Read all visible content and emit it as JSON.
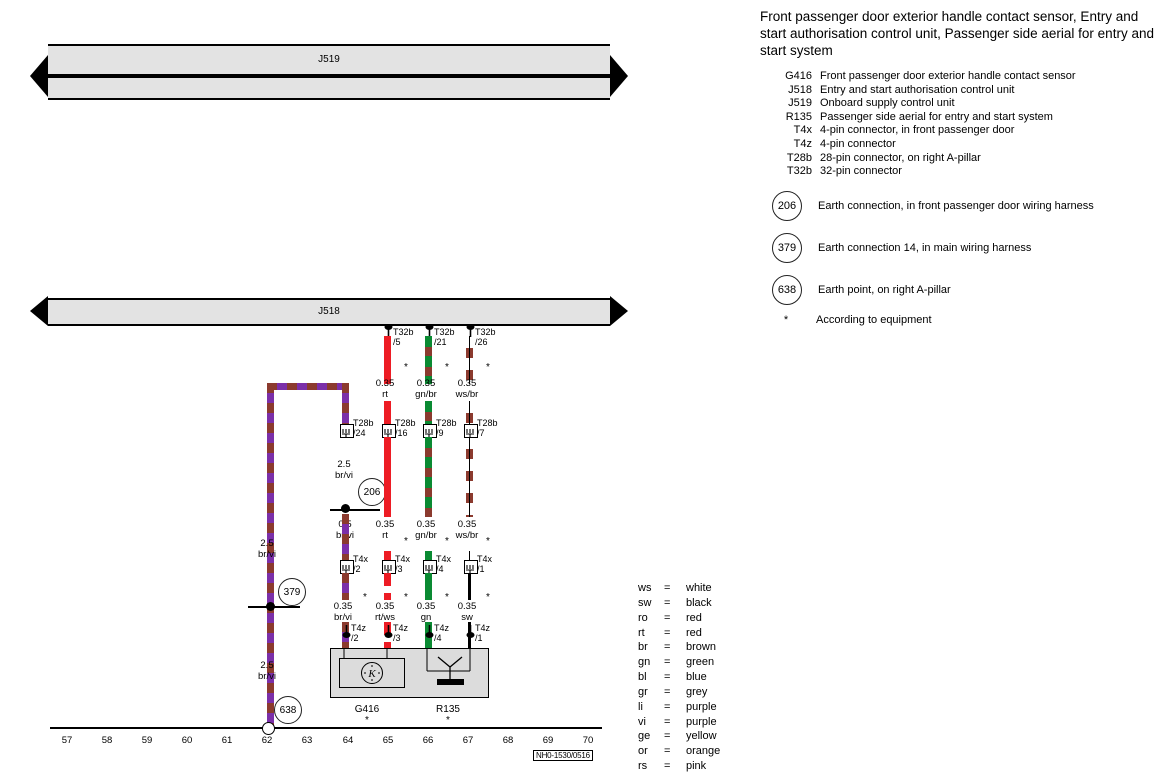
{
  "legend": {
    "title": "Front passenger door exterior handle contact sensor, Entry and start authorisation control unit, Passenger side aerial for entry and start system",
    "codes": [
      {
        "key": "G416",
        "desc": "Front passenger door exterior handle contact sensor"
      },
      {
        "key": "J518",
        "desc": "Entry and start authorisation control unit"
      },
      {
        "key": "J519",
        "desc": "Onboard supply control unit"
      },
      {
        "key": "R135",
        "desc": "Passenger side aerial for entry and start system"
      },
      {
        "key": "T4x",
        "desc": "4-pin connector, in front passenger door"
      },
      {
        "key": "T4z",
        "desc": "4-pin connector"
      },
      {
        "key": "T28b",
        "desc": "28-pin connector, on right A-pillar"
      },
      {
        "key": "T32b",
        "desc": "32-pin connector"
      }
    ],
    "earths": [
      {
        "num": "206",
        "desc": "Earth connection, in front passenger door wiring harness"
      },
      {
        "num": "379",
        "desc": "Earth connection 14, in main wiring harness"
      },
      {
        "num": "638",
        "desc": "Earth point, on right A-pillar"
      }
    ],
    "footnote": {
      "mark": "*",
      "desc": "According to equipment"
    }
  },
  "colour_legend": [
    {
      "abbr": "ws",
      "eq": "=",
      "name": "white"
    },
    {
      "abbr": "sw",
      "eq": "=",
      "name": "black"
    },
    {
      "abbr": "ro",
      "eq": "=",
      "name": "red"
    },
    {
      "abbr": "rt",
      "eq": "=",
      "name": "red"
    },
    {
      "abbr": "br",
      "eq": "=",
      "name": "brown"
    },
    {
      "abbr": "gn",
      "eq": "=",
      "name": "green"
    },
    {
      "abbr": "bl",
      "eq": "=",
      "name": "blue"
    },
    {
      "abbr": "gr",
      "eq": "=",
      "name": "grey"
    },
    {
      "abbr": "li",
      "eq": "=",
      "name": "purple"
    },
    {
      "abbr": "vi",
      "eq": "=",
      "name": "purple"
    },
    {
      "abbr": "ge",
      "eq": "=",
      "name": "yellow"
    },
    {
      "abbr": "or",
      "eq": "=",
      "name": "orange"
    },
    {
      "abbr": "rs",
      "eq": "=",
      "name": "pink"
    }
  ],
  "busbars": {
    "top": {
      "label": "J519"
    },
    "bottom": {
      "label": "J518"
    }
  },
  "connectors": {
    "t32b": [
      {
        "name": "T32b",
        "pin": "/5"
      },
      {
        "name": "T32b",
        "pin": "/21"
      },
      {
        "name": "T32b",
        "pin": "/26"
      }
    ],
    "t28b": [
      {
        "name": "T28b",
        "pin": "/24"
      },
      {
        "name": "T28b",
        "pin": "/16"
      },
      {
        "name": "T28b",
        "pin": "/9"
      },
      {
        "name": "T28b",
        "pin": "/7"
      }
    ],
    "t4x": [
      {
        "name": "T4x",
        "pin": "/2"
      },
      {
        "name": "T4x",
        "pin": "/3"
      },
      {
        "name": "T4x",
        "pin": "/4"
      },
      {
        "name": "T4x",
        "pin": "/1"
      }
    ],
    "t4z": [
      {
        "name": "T4z",
        "pin": "/2"
      },
      {
        "name": "T4z",
        "pin": "/3"
      },
      {
        "name": "T4z",
        "pin": "/4"
      },
      {
        "name": "T4z",
        "pin": "/1"
      }
    ]
  },
  "wire_labels": {
    "upper": [
      {
        "size": "0.35",
        "colour": "rt"
      },
      {
        "size": "0.35",
        "colour": "gn/br"
      },
      {
        "size": "0.35",
        "colour": "ws/br"
      }
    ],
    "mid_left": {
      "size": "2.5",
      "colour": "br/vi"
    },
    "mid": [
      {
        "size": "0.5",
        "colour": "br/vi"
      },
      {
        "size": "0.35",
        "colour": "rt"
      },
      {
        "size": "0.35",
        "colour": "gn/br"
      },
      {
        "size": "0.35",
        "colour": "ws/br"
      }
    ],
    "left_379": {
      "size": "2.5",
      "colour": "br/vi"
    },
    "lower": [
      {
        "size": "0.35",
        "colour": "br/vi"
      },
      {
        "size": "0.35",
        "colour": "rt/ws"
      },
      {
        "size": "0.35",
        "colour": "gn"
      },
      {
        "size": "0.35",
        "colour": "sw"
      }
    ],
    "left_638": {
      "size": "2.5",
      "colour": "br/vi"
    }
  },
  "earth_nodes": {
    "e206": "206",
    "e379": "379",
    "e638": "638"
  },
  "components": {
    "g416": {
      "label": "G416",
      "star": "*",
      "symbol": "K"
    },
    "r135": {
      "label": "R135",
      "star": "*"
    }
  },
  "scale": {
    "numbers": [
      "57",
      "58",
      "59",
      "60",
      "61",
      "62",
      "63",
      "64",
      "65",
      "66",
      "67",
      "68",
      "69",
      "70"
    ],
    "doc_code": "NH0-1530/0516"
  },
  "stars": {
    "mark": "*"
  }
}
